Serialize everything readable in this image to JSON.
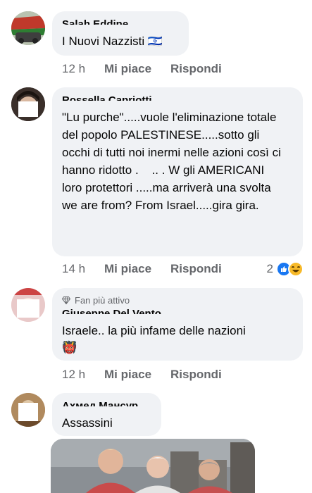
{
  "comments": [
    {
      "author": "Salah Eddine",
      "text": "I Nuovi Nazzisti 🇮🇱",
      "time": "12 h",
      "like_label": "Mi piace",
      "reply_label": "Rispondi"
    },
    {
      "author": "Rossella Capriotti",
      "text": "\"Lu purche\".....vuole l'eliminazione totale del popolo PALESTINESE.....sotto gli occhi di tutti noi inermi nelle azioni così ci hanno ridotto .    .. . W gli AMERICANI loro protettori .....ma arriverà una svolta we are from? From Israel.....gira gira.",
      "time": "14 h",
      "like_label": "Mi piace",
      "reply_label": "Rispondi",
      "reaction_count": "2"
    },
    {
      "badge": "Fan più attivo",
      "author": "Giuseppe Del Vento",
      "text": "Israele.. la più infame delle nazioni",
      "emoji": "👹",
      "time": "12 h",
      "like_label": "Mi piace",
      "reply_label": "Rispondi"
    },
    {
      "author": "Ахмед Мансур",
      "text": "Assassini"
    }
  ],
  "colors": {
    "bubble": "#f0f2f5",
    "meta_text": "#65676b",
    "like_reaction": "#1877f2",
    "haha_reaction": "#f7b928"
  }
}
